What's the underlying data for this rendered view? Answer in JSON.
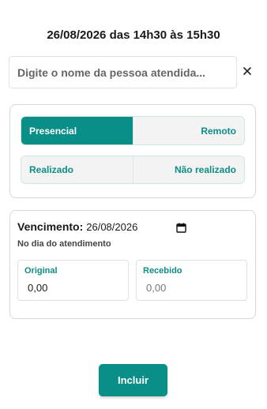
{
  "header": {
    "title": "26/08/2026 das 14h30 às 15h30"
  },
  "search": {
    "placeholder": "Digite o nome da pessoa atendida...",
    "value": ""
  },
  "icons": {
    "clear": "close-icon",
    "calendar": "calendar-icon"
  },
  "mode_toggle": {
    "options": [
      "Presencial",
      "Remoto"
    ],
    "selected": "Presencial"
  },
  "status_toggle": {
    "options": [
      "Realizado",
      "Não realizado"
    ],
    "selected": null
  },
  "due": {
    "label": "Vencimento:",
    "date": "26/08/2026",
    "subtitle": "No dia do atendimento",
    "original_label": "Original",
    "original_value": "0,00",
    "received_label": "Recebido",
    "received_value": "0,00"
  },
  "submit_label": "Incluir",
  "colors": {
    "accent": "#0a8f88",
    "accent_text": "#0e8d86",
    "segment_bg": "#f3f3f3"
  }
}
